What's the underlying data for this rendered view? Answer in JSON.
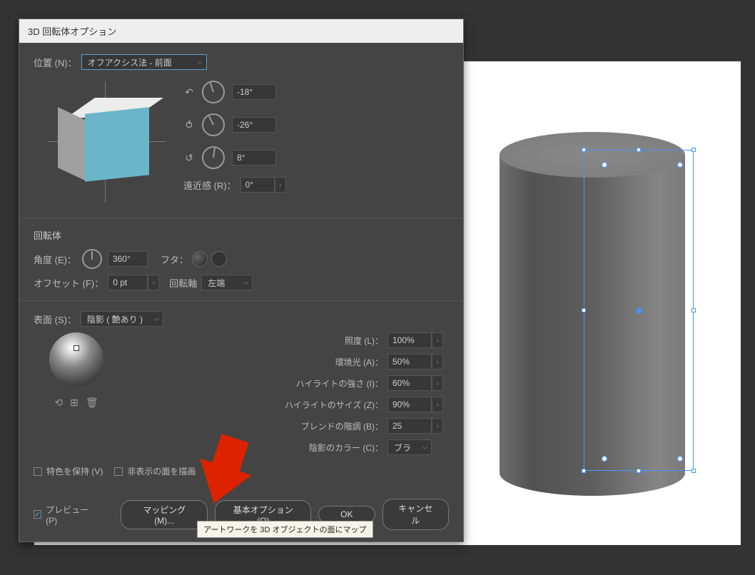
{
  "dialog": {
    "title": "3D 回転体オプション",
    "position_label": "位置 (N)：",
    "position_value": "オフアクシス法 - 前面",
    "rotation": {
      "x": "-18°",
      "y": "-26°",
      "z": "8°"
    },
    "perspective_label": "遠近感 (R)：",
    "perspective_value": "0°",
    "revolve_section": "回転体",
    "angle_label": "角度 (E)：",
    "angle_value": "360°",
    "cap_label": "フタ：",
    "offset_label": "オフセット (F)：",
    "offset_value": "0 pt",
    "axis_label": "回転軸",
    "axis_value": "左端",
    "surface_label": "表面 (S)：",
    "surface_value": "陰影 ( 艶あり )",
    "light": {
      "intensity_label": "照度 (L)：",
      "intensity_value": "100%",
      "ambient_label": "環境光 (A)：",
      "ambient_value": "50%",
      "highlight_intensity_label": "ハイライトの強さ (I)：",
      "highlight_intensity_value": "60%",
      "highlight_size_label": "ハイライトのサイズ (Z)：",
      "highlight_size_value": "90%",
      "blend_steps_label": "ブレンドの階調 (B)：",
      "blend_steps_value": "25",
      "shade_color_label": "陰影のカラー (C)：",
      "shade_color_value": "ブラ"
    },
    "preserve_spot_label": "特色を保持 (V)",
    "draw_hidden_label": "非表示の面を描画",
    "preview_label": "プレビュー (P)",
    "map_art_button": "マッピング (M)...",
    "fewer_options_button": "基本オプション (O)",
    "ok_button": "OK",
    "cancel_button": "キャンセル"
  },
  "tooltip": "アートワークを 3D オブジェクトの面にマップ"
}
